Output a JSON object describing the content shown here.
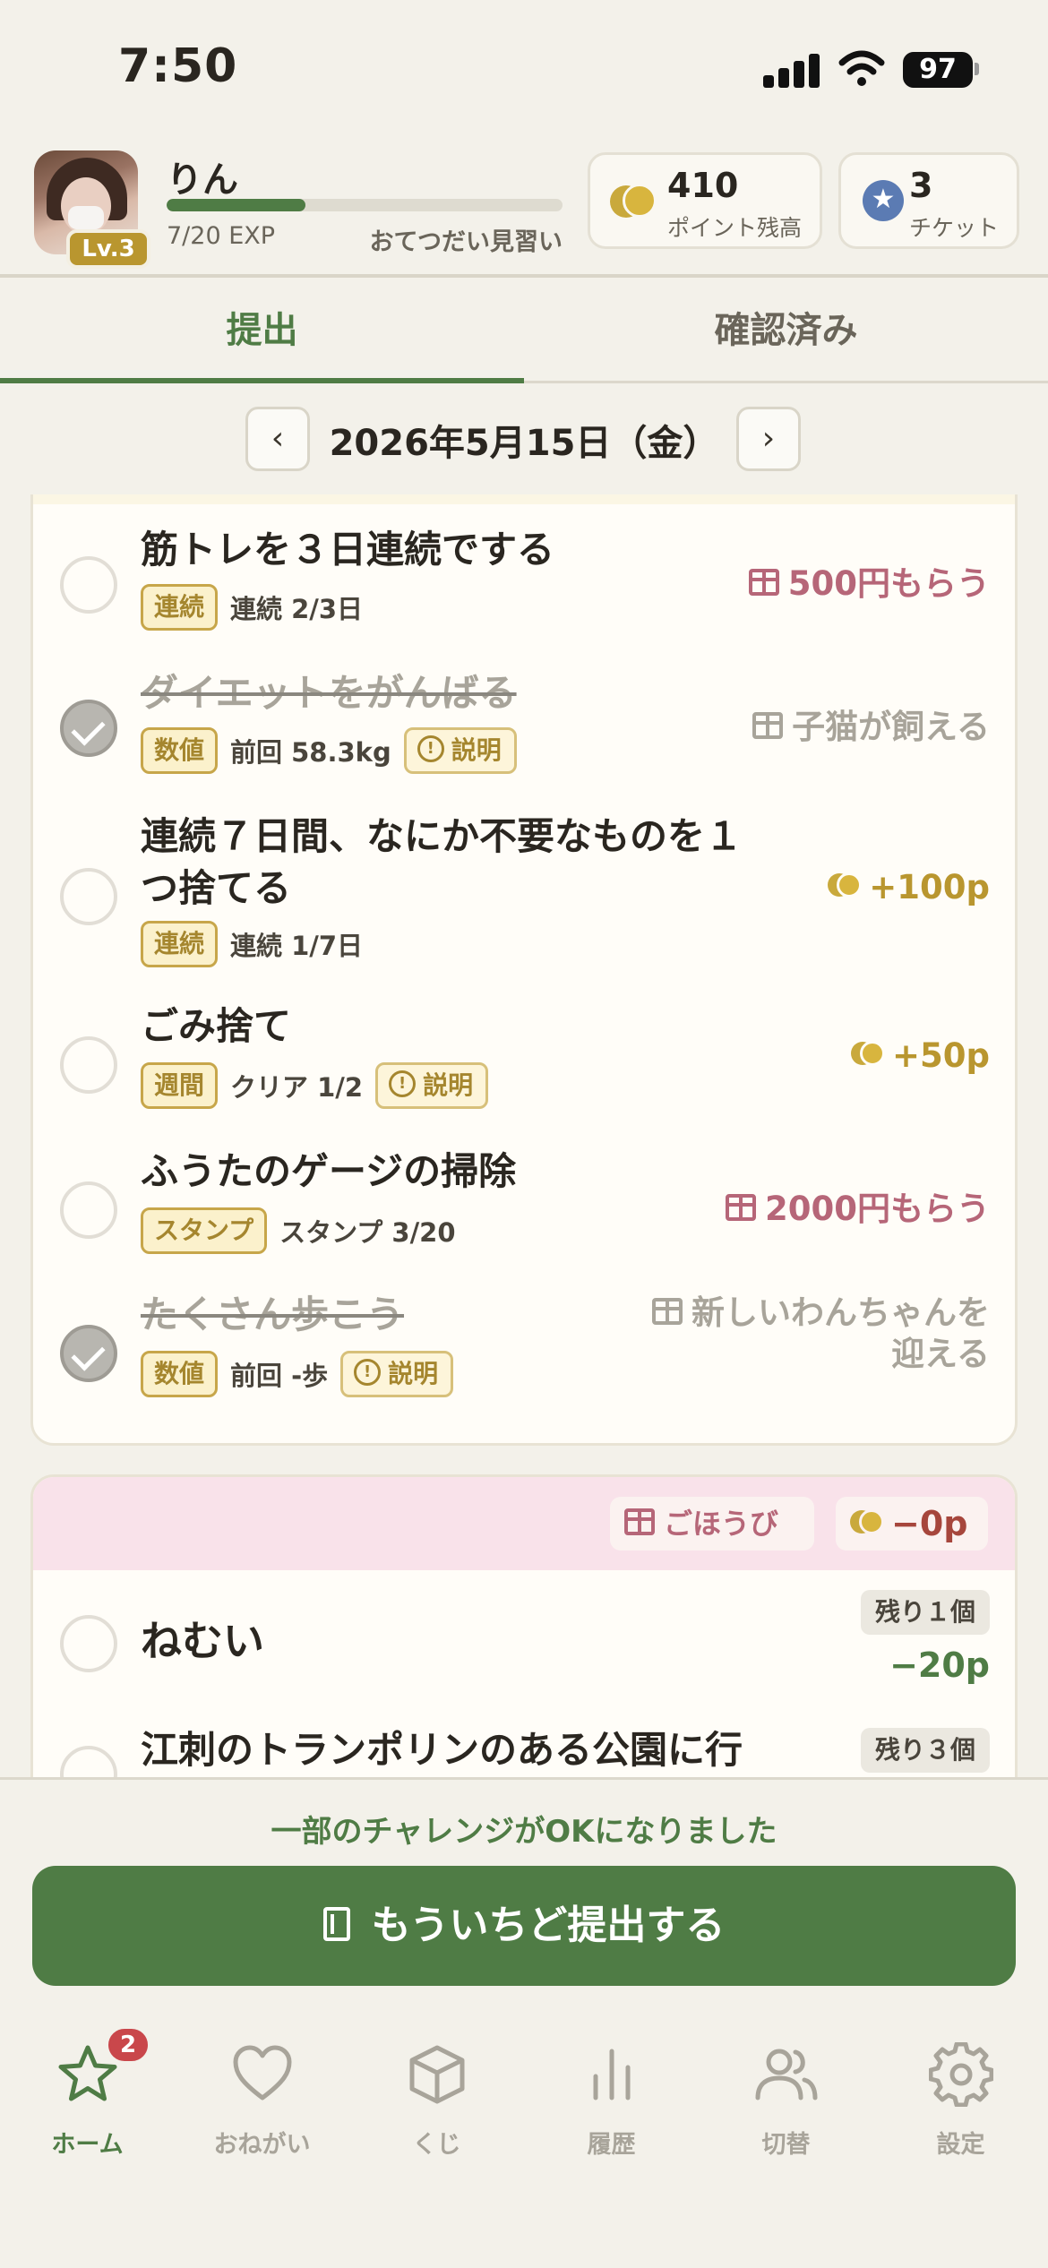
{
  "status_bar": {
    "time": "7:50",
    "battery": "97"
  },
  "header": {
    "username": "りん",
    "level": "Lv.3",
    "exp_text": "7/20 EXP",
    "exp_progress": 0.35,
    "rank": "おてつだい見習い",
    "points": {
      "value": "410",
      "label": "ポイント残高"
    },
    "tickets": {
      "value": "3",
      "label": "チケット"
    }
  },
  "tabs": [
    {
      "label": "提出",
      "active": true
    },
    {
      "label": "確認済み",
      "active": false
    }
  ],
  "date_nav": {
    "prev": "‹",
    "date": "2026年5月15日（金）",
    "next": "›"
  },
  "tasks": [
    {
      "title": "筋トレを３日連続でする",
      "done": false,
      "tag": "連続",
      "info": "連続 2/3日",
      "explain": "",
      "reward": "500円もらう",
      "reward_type": "gift"
    },
    {
      "title": "ダイエットをがんばる",
      "done": true,
      "tag": "数値",
      "info": "前回 58.3kg",
      "explain": "説明",
      "reward": "子猫が飼える",
      "reward_type": "muted"
    },
    {
      "title_line1": "連続７日間、なにか不要なものを１",
      "title_line2": "つ捨てる",
      "done": false,
      "tag": "連続",
      "info": "連続 1/7日",
      "explain": "",
      "reward": "+100p",
      "reward_type": "pts"
    },
    {
      "title": "ごみ捨て",
      "done": false,
      "tag": "週間",
      "info": "クリア 1/2",
      "explain": "説明",
      "reward": "+50p",
      "reward_type": "pts"
    },
    {
      "title": "ふうたのゲージの掃除",
      "done": false,
      "tag": "スタンプ",
      "info": "スタンプ 3/20",
      "explain": "",
      "reward": "2000円もらう",
      "reward_type": "gift"
    },
    {
      "title": "たくさん歩こう",
      "done": true,
      "tag": "数値",
      "info": "前回 -歩",
      "explain": "説明",
      "reward_line1": "新しいわんちゃんを",
      "reward_line2": "迎える",
      "reward_type": "muted"
    }
  ],
  "rewards_card": {
    "gift_label": "ごほうび",
    "points_label": "−0p",
    "items": [
      {
        "title": "ねむい",
        "remaining": "残り１個",
        "cost": "−20p"
      },
      {
        "title": "江刺のトランポリンのある公園に行",
        "remaining": "残り３個",
        "cost": ""
      }
    ]
  },
  "submit": {
    "notice": "一部のチャレンジがOKになりました",
    "button": "もういちど提出する"
  },
  "bottom_nav": [
    {
      "label": "ホーム",
      "icon": "star-icon",
      "active": true,
      "badge": "2"
    },
    {
      "label": "おねがい",
      "icon": "heart-icon",
      "active": false
    },
    {
      "label": "くじ",
      "icon": "box-icon",
      "active": false
    },
    {
      "label": "履歴",
      "icon": "bar-chart-icon",
      "active": false
    },
    {
      "label": "切替",
      "icon": "users-icon",
      "active": false
    },
    {
      "label": "設定",
      "icon": "gear-icon",
      "active": false
    }
  ],
  "colors": {
    "accent": "#4f7c45",
    "gold": "#c9a93c",
    "gift": "#b66678",
    "badge": "#c9474b"
  }
}
